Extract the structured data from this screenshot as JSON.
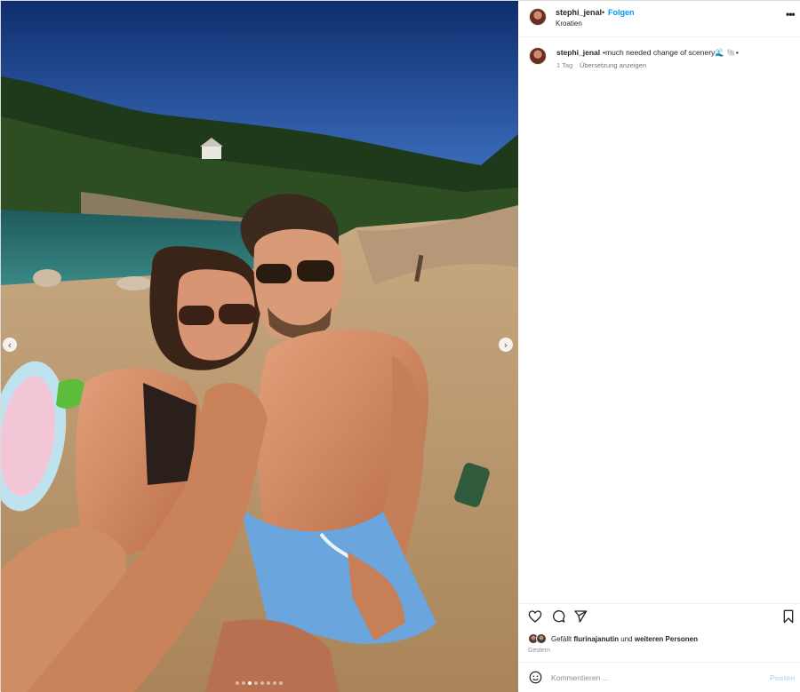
{
  "header": {
    "username": "stephi_jenal",
    "separator": "•",
    "follow_label": "Folgen",
    "location": "Kroatien",
    "more_icon": "more-horizontal-icon"
  },
  "caption": {
    "username": "stephi_jenal",
    "text": "•much needed change of scenery🌊 🐚•",
    "time": "1 Tag",
    "translate_label": "Übersetzung anzeigen"
  },
  "actions": {
    "icons": [
      "heart-icon",
      "comment-icon",
      "share-icon",
      "bookmark-icon"
    ]
  },
  "likes": {
    "prefix": "Gefällt",
    "user": "flurinajanutin",
    "joiner": "und",
    "others": "weiteren Personen"
  },
  "date": "Gestern",
  "comment": {
    "placeholder": "Kommentieren ...",
    "post_label": "Posten"
  },
  "carousel": {
    "total_slides": 8,
    "current_slide": 3
  },
  "colors": {
    "link": "#0095f6",
    "post_disabled": "#b2dffc",
    "muted": "#8e8e8e"
  }
}
